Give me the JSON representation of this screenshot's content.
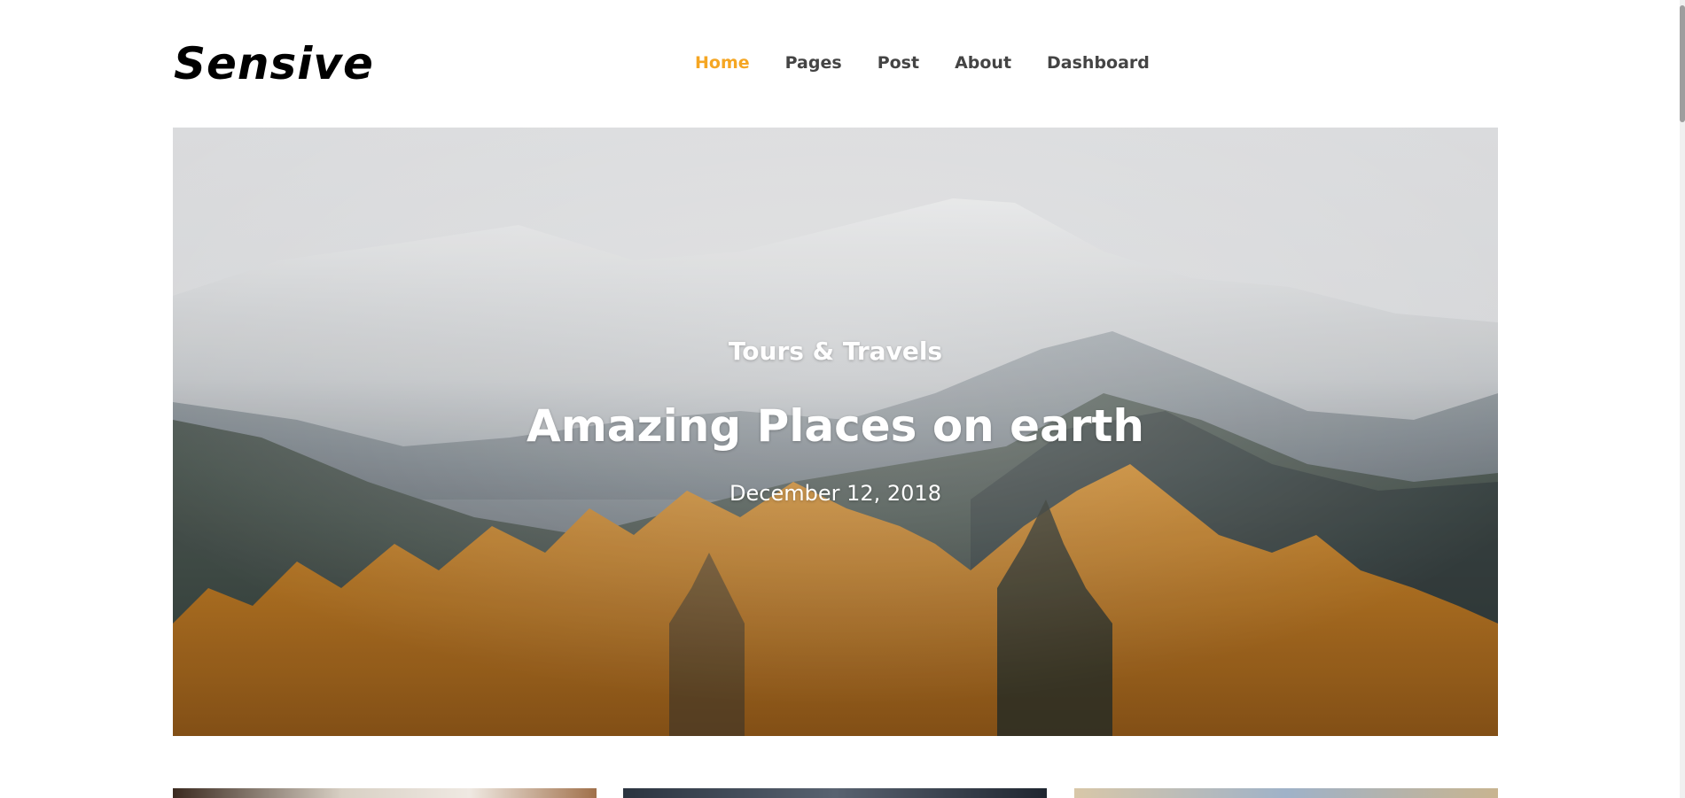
{
  "brand": {
    "logo_text": "Sensive"
  },
  "nav": {
    "items": [
      {
        "label": "Home",
        "active": true
      },
      {
        "label": "Pages",
        "active": false
      },
      {
        "label": "Post",
        "active": false
      },
      {
        "label": "About",
        "active": false
      },
      {
        "label": "Dashboard",
        "active": false
      }
    ]
  },
  "hero": {
    "category": "Tours & Travels",
    "title": "Amazing Places on earth",
    "date": "December 12, 2018"
  },
  "colors": {
    "accent": "#f5a623",
    "nav_text": "#444444",
    "hero_text": "#ffffff"
  }
}
